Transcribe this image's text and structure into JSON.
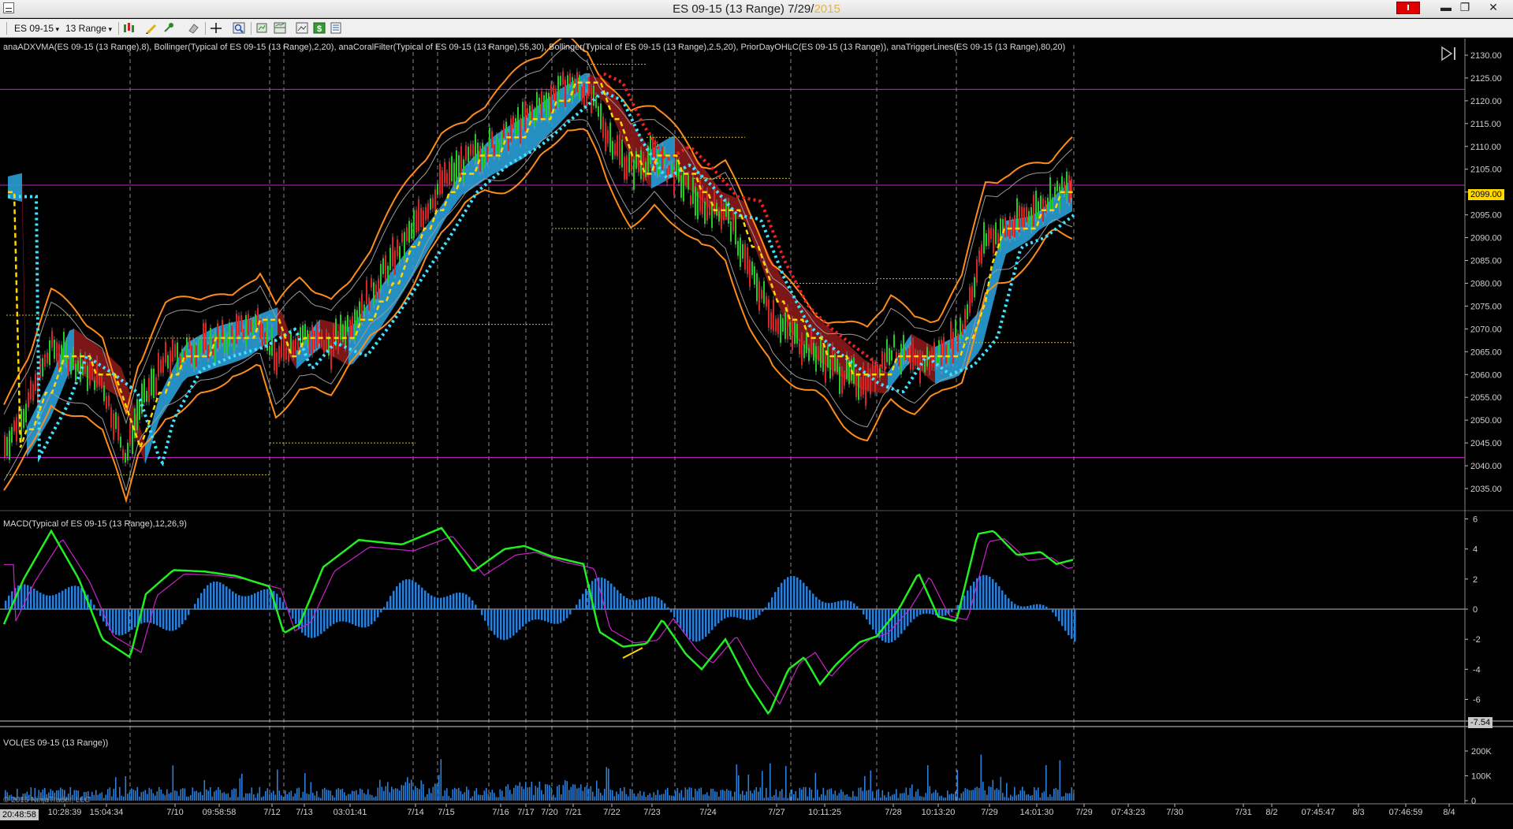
{
  "window": {
    "title_main": "ES 09-15 (13 Range)  7/29/",
    "title_year": "2015",
    "min_glyph": "▬",
    "max_glyph": "❐",
    "close_glyph": "✕"
  },
  "toolbar": {
    "instrument": "ES 09-15",
    "period": "13 Range",
    "icons": [
      "bar-type-icon",
      "pencil-draw-icon",
      "pin-icon",
      "eraser-icon",
      "crosshair-icon",
      "zoom-icon",
      "scroll-chart-icon",
      "panel-layout-icon",
      "screenshot-icon",
      "dollar-icon",
      "data-box-icon"
    ]
  },
  "indicators": {
    "price_panel": "anaADXVMA(ES 09-15 (13 Range),8), Bollinger(Typical of ES 09-15 (13 Range),2,20), anaCoralFilter(Typical of ES 09-15 (13 Range),55,30), Bollinger(Typical of ES 09-15 (13 Range),2.5,20), PriorDayOHLC(ES 09-15 (13 Range)), anaTriggerLines(ES 09-15 (13 Range),80,20)",
    "macd_panel": "MACD(Typical of ES 09-15 (13 Range),12,26,9)",
    "vol_panel": "VOL(ES 09-15 (13 Range))",
    "copyright": "© 2015 NinjaTrader, LLC"
  },
  "price_axis": {
    "ticks": [
      "2130.00",
      "2125.00",
      "2120.00",
      "2115.00",
      "2110.00",
      "2105.00",
      "2100.00",
      "2095.00",
      "2090.00",
      "2085.00",
      "2080.00",
      "2075.00",
      "2070.00",
      "2065.00",
      "2060.00",
      "2055.00",
      "2050.00",
      "2045.00",
      "2040.00",
      "2035.00"
    ],
    "current_price": "2099.00",
    "current_price_color": "#ffd700"
  },
  "macd_axis": {
    "ticks": [
      "6",
      "4",
      "2",
      "0",
      "-2",
      "-4",
      "-6"
    ],
    "current_value": "-7.54"
  },
  "vol_axis": {
    "ticks": [
      "200K",
      "100K",
      "0"
    ]
  },
  "time_axis": {
    "cursor_time": "20:48:58",
    "labels": [
      "10:28:39",
      "15:04:34",
      "7/10",
      "09:58:58",
      "7/12",
      "7/13",
      "03:01:41",
      "7/14",
      "7/15",
      "7/16",
      "7/17",
      "7/20",
      "7/21",
      "7/22",
      "7/23",
      "7/24",
      "7/27",
      "10:11:25",
      "7/28",
      "10:13:20",
      "7/29",
      "14:01:30",
      "7/29",
      "07:43:23",
      "7/30",
      "7/31",
      "8/2",
      "07:45:47",
      "8/3",
      "07:46:59",
      "8/4"
    ]
  },
  "colors": {
    "bollinger_outer": "#ff8c1a",
    "bollinger_inner": "#9a9a9a",
    "coral_up": "#2a9fd6",
    "coral_down": "#8b1a1a",
    "trigger_line": "#40e0ff",
    "adxvma": "#ffd700",
    "macd_line": "#22ee22",
    "signal_line": "#cc22cc",
    "histogram": "#2a7fd8",
    "pivot_lines": "#cc22cc",
    "volume": "#2a7fd8"
  }
}
